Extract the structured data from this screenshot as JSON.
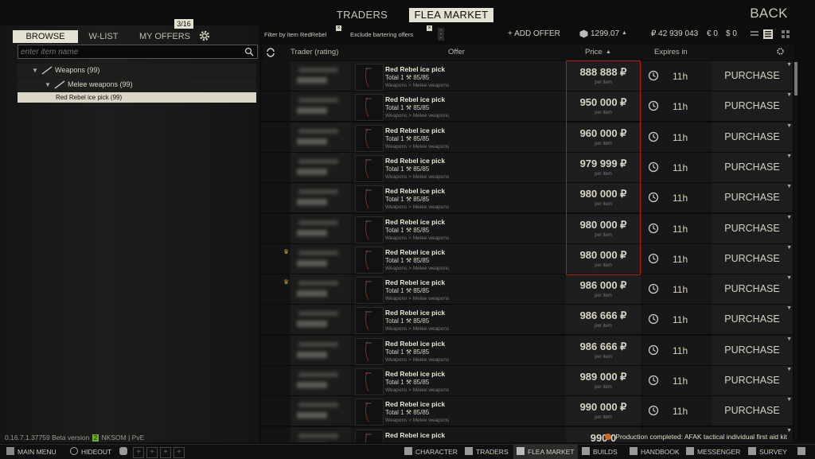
{
  "nav": {
    "traders": "TRADERS",
    "flea_market": "FLEA MARKET",
    "back": "BACK"
  },
  "left_tabs": {
    "browse": "BROWSE",
    "wlist": "W-LIST",
    "my_offers": "MY OFFERS",
    "offers_count": "3/16"
  },
  "search": {
    "placeholder": "enter item name"
  },
  "tree": [
    {
      "label": "Weapons (99)"
    },
    {
      "label": "Melee weapons (99)"
    },
    {
      "label": "Red Rebel ice pick (99)"
    }
  ],
  "filters": {
    "by_item": "Filter by item RedRebel",
    "exclude_barter": "Exclude bartering offers",
    "add_offer": "+ ADD OFFER"
  },
  "balances": {
    "gp": "1299.07",
    "roubles": "₽ 42 939 043",
    "euros": "€ 0",
    "dollars": "$ 0"
  },
  "columns": {
    "trader": "Trader (rating)",
    "offer": "Offer",
    "price": "Price",
    "expires": "Expires in"
  },
  "offers": [
    {
      "name": "Red Rebel ice pick",
      "total": "Total 1",
      "durability": "85/85",
      "category": "Weapons > Melee weapons",
      "price": "888 888 ₽",
      "unit": "per item",
      "expires": "11h",
      "action": "PURCHASE",
      "crown": false
    },
    {
      "name": "Red Rebel ice pick",
      "total": "Total 1",
      "durability": "85/85",
      "category": "Weapons > Melee weapons",
      "price": "950 000 ₽",
      "unit": "per item",
      "expires": "11h",
      "action": "PURCHASE",
      "crown": false
    },
    {
      "name": "Red Rebel ice pick",
      "total": "Total 1",
      "durability": "85/85",
      "category": "Weapons > Melee weapons",
      "price": "960 000 ₽",
      "unit": "per item",
      "expires": "11h",
      "action": "PURCHASE",
      "crown": false
    },
    {
      "name": "Red Rebel ice pick",
      "total": "Total 1",
      "durability": "85/85",
      "category": "Weapons > Melee weapons",
      "price": "979 999 ₽",
      "unit": "per item",
      "expires": "11h",
      "action": "PURCHASE",
      "crown": false
    },
    {
      "name": "Red Rebel ice pick",
      "total": "Total 1",
      "durability": "85/85",
      "category": "Weapons > Melee weapons",
      "price": "980 000 ₽",
      "unit": "per item",
      "expires": "11h",
      "action": "PURCHASE",
      "crown": false
    },
    {
      "name": "Red Rebel ice pick",
      "total": "Total 1",
      "durability": "85/85",
      "category": "Weapons > Melee weapons",
      "price": "980 000 ₽",
      "unit": "per item",
      "expires": "11h",
      "action": "PURCHASE",
      "crown": false
    },
    {
      "name": "Red Rebel ice pick",
      "total": "Total 1",
      "durability": "85/85",
      "category": "Weapons > Melee weapons",
      "price": "980 000 ₽",
      "unit": "per item",
      "expires": "11h",
      "action": "PURCHASE",
      "crown": true
    },
    {
      "name": "Red Rebel ice pick",
      "total": "Total 1",
      "durability": "85/85",
      "category": "Weapons > Melee weapons",
      "price": "986 000 ₽",
      "unit": "per item",
      "expires": "11h",
      "action": "PURCHASE",
      "crown": true
    },
    {
      "name": "Red Rebel ice pick",
      "total": "Total 1",
      "durability": "85/85",
      "category": "Weapons > Melee weapons",
      "price": "986 666 ₽",
      "unit": "per item",
      "expires": "11h",
      "action": "PURCHASE",
      "crown": false
    },
    {
      "name": "Red Rebel ice pick",
      "total": "Total 1",
      "durability": "85/85",
      "category": "Weapons > Melee weapons",
      "price": "986 666 ₽",
      "unit": "per item",
      "expires": "11h",
      "action": "PURCHASE",
      "crown": false
    },
    {
      "name": "Red Rebel ice pick",
      "total": "Total 1",
      "durability": "85/85",
      "category": "Weapons > Melee weapons",
      "price": "989 000 ₽",
      "unit": "per item",
      "expires": "11h",
      "action": "PURCHASE",
      "crown": false
    },
    {
      "name": "Red Rebel ice pick",
      "total": "Total 1",
      "durability": "85/85",
      "category": "Weapons > Melee weapons",
      "price": "990 000 ₽",
      "unit": "per item",
      "expires": "11h",
      "action": "PURCHASE",
      "crown": false
    },
    {
      "name": "Red Rebel ice pick",
      "total": "",
      "durability": "",
      "category": "",
      "price": "990 0",
      "unit": "",
      "expires": "",
      "action": "",
      "crown": false
    }
  ],
  "footer": {
    "version": "0.16.7.1.37759 Beta version",
    "version_tail": "NKSOM | PvE",
    "badge": "2",
    "toast": "Production completed: AFAK tactical individual first aid kit"
  },
  "bottom_bar": {
    "main_menu": "MAIN MENU",
    "hideout": "HIDEOUT",
    "character": "CHARACTER",
    "traders": "TRADERS",
    "flea_market": "FLEA MARKET",
    "builds": "BUILDS",
    "handbook": "HANDBOOK",
    "messenger": "MESSENGER",
    "survey": "SURVEY"
  },
  "colors": {
    "accent": "#e4e2d2",
    "highlight": "#c21a1a",
    "crown": "#c9a227"
  }
}
